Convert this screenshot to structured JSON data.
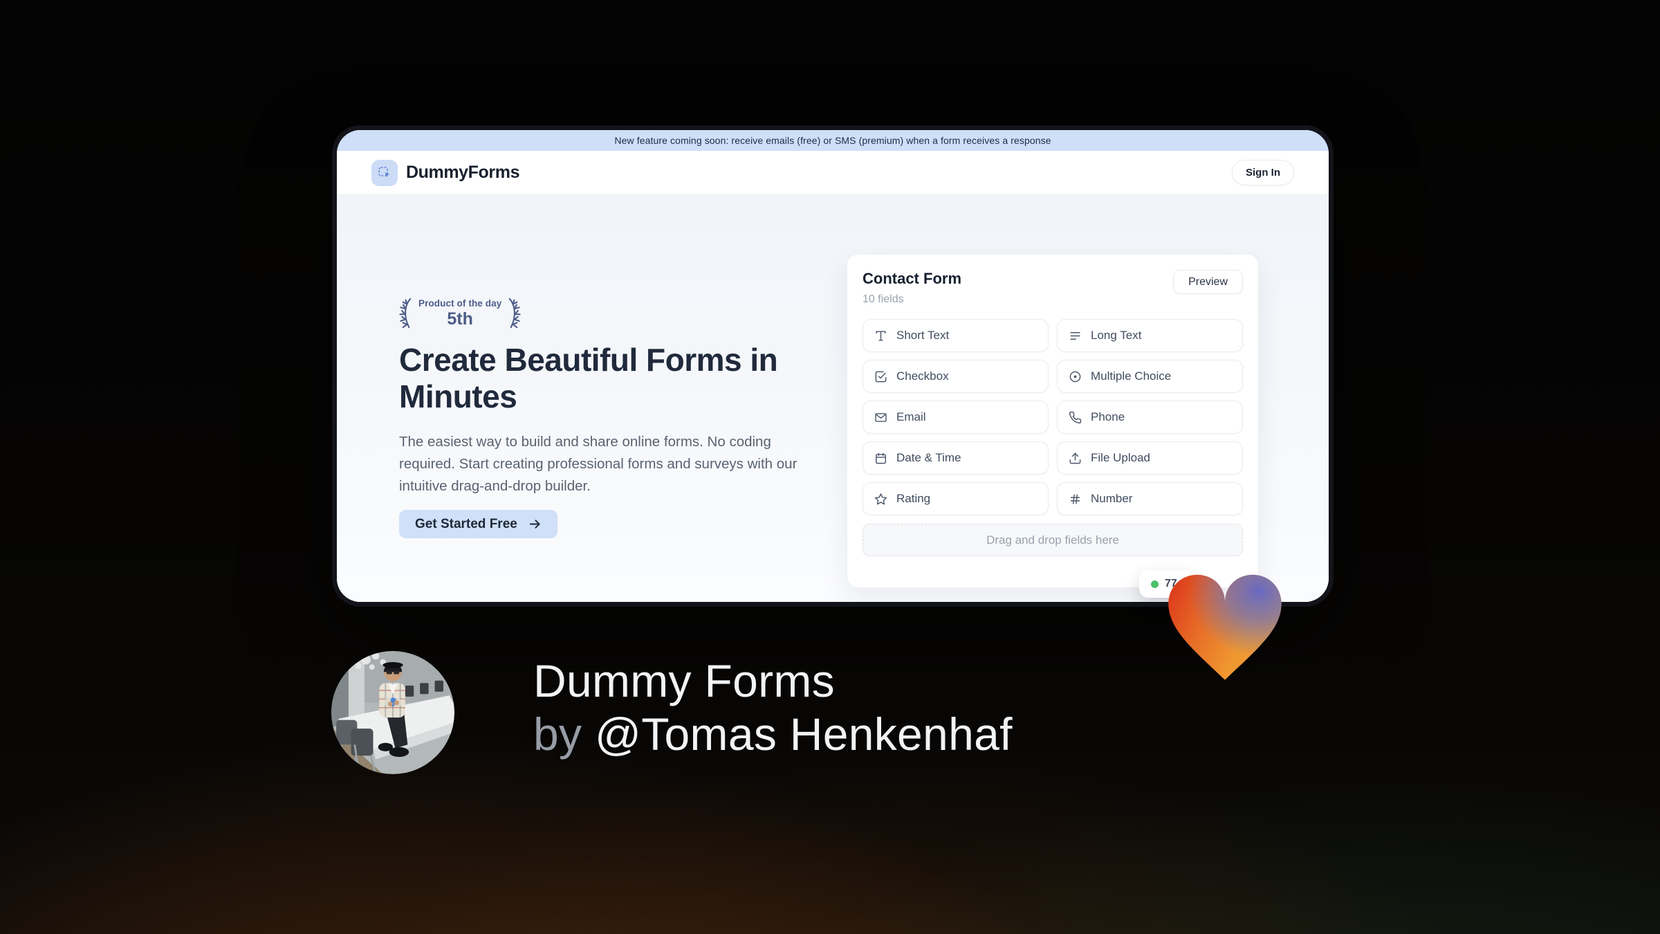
{
  "banner": {
    "text": "New feature coming soon: receive emails (free) or SMS (premium) when a form receives a response"
  },
  "nav": {
    "brand": "DummyForms",
    "sign_in": "Sign In"
  },
  "hero": {
    "award": {
      "title": "Product of the day",
      "rank": "5th"
    },
    "headline_line1": "Create Beautiful Forms in",
    "headline_line2": "Minutes",
    "description": "The easiest way to build and share online forms. No coding required. Start creating professional forms and surveys with our intuitive drag-and-drop builder.",
    "cta": "Get Started Free"
  },
  "form_card": {
    "title": "Contact Form",
    "field_count": "10 fields",
    "preview": "Preview",
    "fields": [
      {
        "label": "Short Text",
        "icon": "short-text-icon"
      },
      {
        "label": "Long Text",
        "icon": "long-text-icon"
      },
      {
        "label": "Checkbox",
        "icon": "checkbox-icon"
      },
      {
        "label": "Multiple Choice",
        "icon": "multiple-choice-icon"
      },
      {
        "label": "Email",
        "icon": "email-icon"
      },
      {
        "label": "Phone",
        "icon": "phone-icon"
      },
      {
        "label": "Date & Time",
        "icon": "date-time-icon"
      },
      {
        "label": "File Upload",
        "icon": "file-upload-icon"
      },
      {
        "label": "Rating",
        "icon": "rating-icon"
      },
      {
        "label": "Number",
        "icon": "number-icon"
      }
    ],
    "dropzone": "Drag and drop fields here",
    "status": {
      "value": "77",
      "dot_color": "#4bc16c"
    }
  },
  "attribution": {
    "line1": "Dummy Forms",
    "by": "by",
    "author": "@Tomas Henkenhaf"
  },
  "colors": {
    "accent_blue": "#cfe0f8",
    "navy": "#1e2738",
    "laurel": "#4d5c87",
    "status_green": "#4bc16c",
    "heart_red": "#dd3a1c",
    "heart_orange": "#ef9730",
    "heart_violet": "#6668c5"
  }
}
